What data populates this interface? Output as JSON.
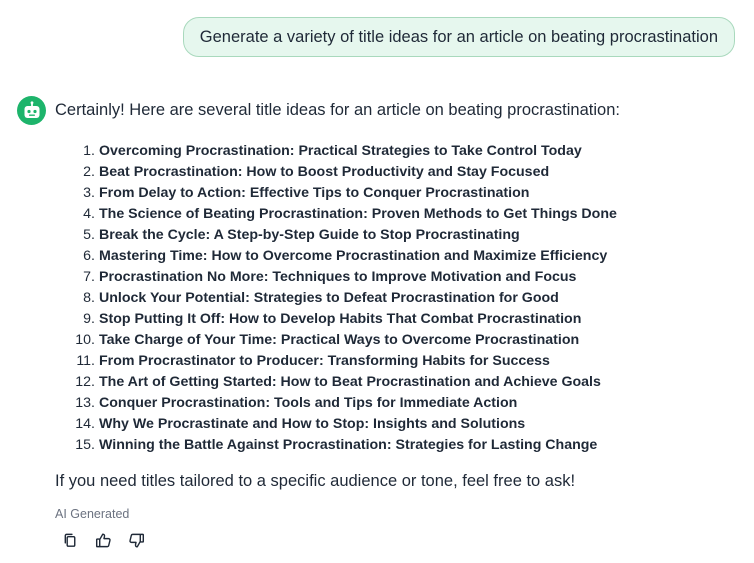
{
  "user_message": {
    "text": "Generate a variety of title ideas for an article on beating procrastination"
  },
  "assistant": {
    "avatar_icon": "robot-icon",
    "intro": "Certainly! Here are several title ideas for an article on beating procrastination:",
    "titles": [
      {
        "num": "1.",
        "text": "Overcoming Procrastination: Practical Strategies to Take Control Today"
      },
      {
        "num": "2.",
        "text": "Beat Procrastination: How to Boost Productivity and Stay Focused"
      },
      {
        "num": "3.",
        "text": "From Delay to Action: Effective Tips to Conquer Procrastination"
      },
      {
        "num": "4.",
        "text": "The Science of Beating Procrastination: Proven Methods to Get Things Done"
      },
      {
        "num": "5.",
        "text": "Break the Cycle: A Step-by-Step Guide to Stop Procrastinating"
      },
      {
        "num": "6.",
        "text": "Mastering Time: How to Overcome Procrastination and Maximize Efficiency"
      },
      {
        "num": "7.",
        "text": "Procrastination No More: Techniques to Improve Motivation and Focus"
      },
      {
        "num": "8.",
        "text": "Unlock Your Potential: Strategies to Defeat Procrastination for Good"
      },
      {
        "num": "9.",
        "text": "Stop Putting It Off: How to Develop Habits That Combat Procrastination"
      },
      {
        "num": "10.",
        "text": "Take Charge of Your Time: Practical Ways to Overcome Procrastination"
      },
      {
        "num": "11.",
        "text": "From Procrastinator to Producer: Transforming Habits for Success"
      },
      {
        "num": "12.",
        "text": "The Art of Getting Started: How to Beat Procrastination and Achieve Goals"
      },
      {
        "num": "13.",
        "text": "Conquer Procrastination: Tools and Tips for Immediate Action"
      },
      {
        "num": "14.",
        "text": "Why We Procrastinate and How to Stop: Insights and Solutions"
      },
      {
        "num": "15.",
        "text": "Winning the Battle Against Procrastination: Strategies for Lasting Change"
      }
    ],
    "outro": "If you need titles tailored to a specific audience or tone, feel free to ask!",
    "ai_label": "AI Generated"
  },
  "actions": [
    {
      "icon": "copy-icon"
    },
    {
      "icon": "thumbs-up-icon"
    },
    {
      "icon": "thumbs-down-icon"
    }
  ],
  "colors": {
    "user_bubble_bg": "#e6f7ee",
    "user_bubble_border": "#a9d9bd",
    "avatar_bg": "#1db46b",
    "text": "#1f2937",
    "muted": "#6b7280"
  }
}
